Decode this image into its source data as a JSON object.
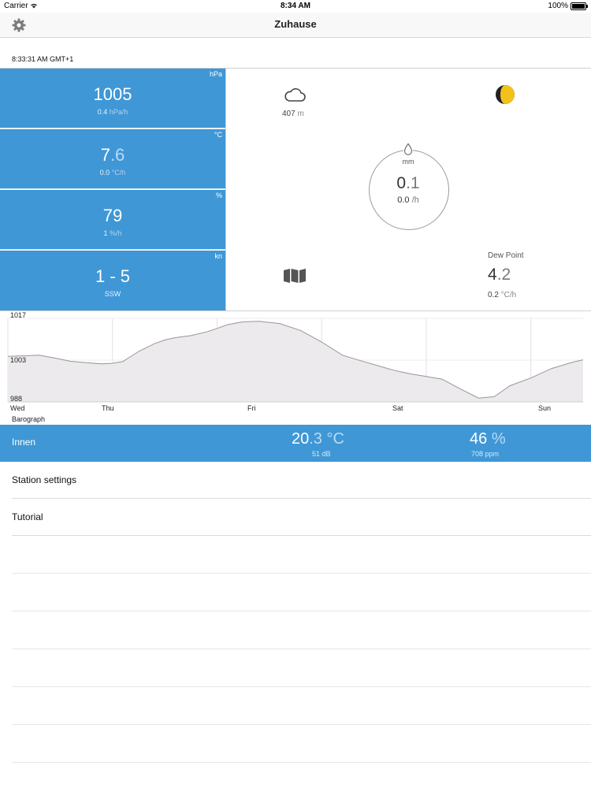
{
  "status_bar": {
    "carrier": "Carrier",
    "time": "8:34 AM",
    "battery": "100%"
  },
  "nav": {
    "title": "Zuhause",
    "settings_icon": "gear-icon"
  },
  "timestamp": "8:33:31 AM GMT+1",
  "pressure": {
    "unit": "hPa",
    "value_int": "1005",
    "value_dec": "",
    "trend_value": "0.4",
    "trend_unit": "hPa/h"
  },
  "temperature": {
    "unit": "°C",
    "value_int": "7",
    "value_dec": ".6",
    "trend_value": "0.0",
    "trend_unit": "°C/h"
  },
  "humidity": {
    "unit": "%",
    "value_int": "79",
    "value_dec": "",
    "trend_value": "1",
    "trend_unit": "%/h"
  },
  "wind": {
    "unit": "kn",
    "value": "1 - 5",
    "direction": "SSW"
  },
  "cloud": {
    "icon": "cloud-icon",
    "value": "407",
    "unit": "m"
  },
  "moon": {
    "icon": "moon-phase-icon"
  },
  "rain": {
    "icon": "raindrop-icon",
    "unit": "mm",
    "value_int": "0",
    "value_dec": ".1",
    "rate_value": "0.0",
    "rate_unit": "/h"
  },
  "map": {
    "icon": "map-icon"
  },
  "dew_point": {
    "label": "Dew Point",
    "value_int": "4",
    "value_dec": ".2",
    "trend_value": "0.2",
    "trend_unit": "°C/h"
  },
  "chart_data": {
    "type": "area",
    "title": "Barograph",
    "ytick_labels": [
      "1017",
      "1003",
      "988"
    ],
    "ylim": [
      988,
      1017
    ],
    "xtick_labels": [
      "Wed",
      "Thu",
      "Fri",
      "Sat",
      "Sun"
    ],
    "x": [
      0,
      0.15,
      0.3,
      0.45,
      0.6,
      0.75,
      0.9,
      1.0,
      1.1,
      1.25,
      1.4,
      1.5,
      1.6,
      1.75,
      1.9,
      2.0,
      2.1,
      2.25,
      2.4,
      2.6,
      2.8,
      3.0,
      3.2,
      3.4,
      3.5,
      3.6,
      3.7,
      3.85,
      4.0,
      4.15,
      4.3,
      4.5,
      4.65,
      4.8,
      5.0,
      5.2,
      5.4,
      5.5
    ],
    "values": [
      1003.8,
      1004.0,
      1004.2,
      1003.2,
      1002.1,
      1001.6,
      1001.2,
      1001.4,
      1002.0,
      1005.5,
      1008.2,
      1009.5,
      1010.3,
      1011.0,
      1012.3,
      1013.5,
      1014.8,
      1015.8,
      1016.0,
      1015.2,
      1012.8,
      1008.8,
      1004.2,
      1002.0,
      1001.0,
      999.9,
      998.9,
      997.7,
      996.8,
      995.9,
      993.0,
      989.3,
      989.8,
      993.6,
      996.3,
      999.6,
      1001.8,
      1002.6
    ]
  },
  "indoor": {
    "label": "Innen",
    "temp_int": "20",
    "temp_dec": ".3",
    "temp_unit": "°C",
    "noise": "51 dB",
    "humidity_value": "46",
    "humidity_unit": "%",
    "co2": "708 ppm"
  },
  "menu": {
    "station_settings": "Station settings",
    "tutorial": "Tutorial"
  },
  "colors": {
    "accent": "#3f97d6",
    "chart_fill": "#eceaed",
    "chart_line": "#9a9499"
  }
}
